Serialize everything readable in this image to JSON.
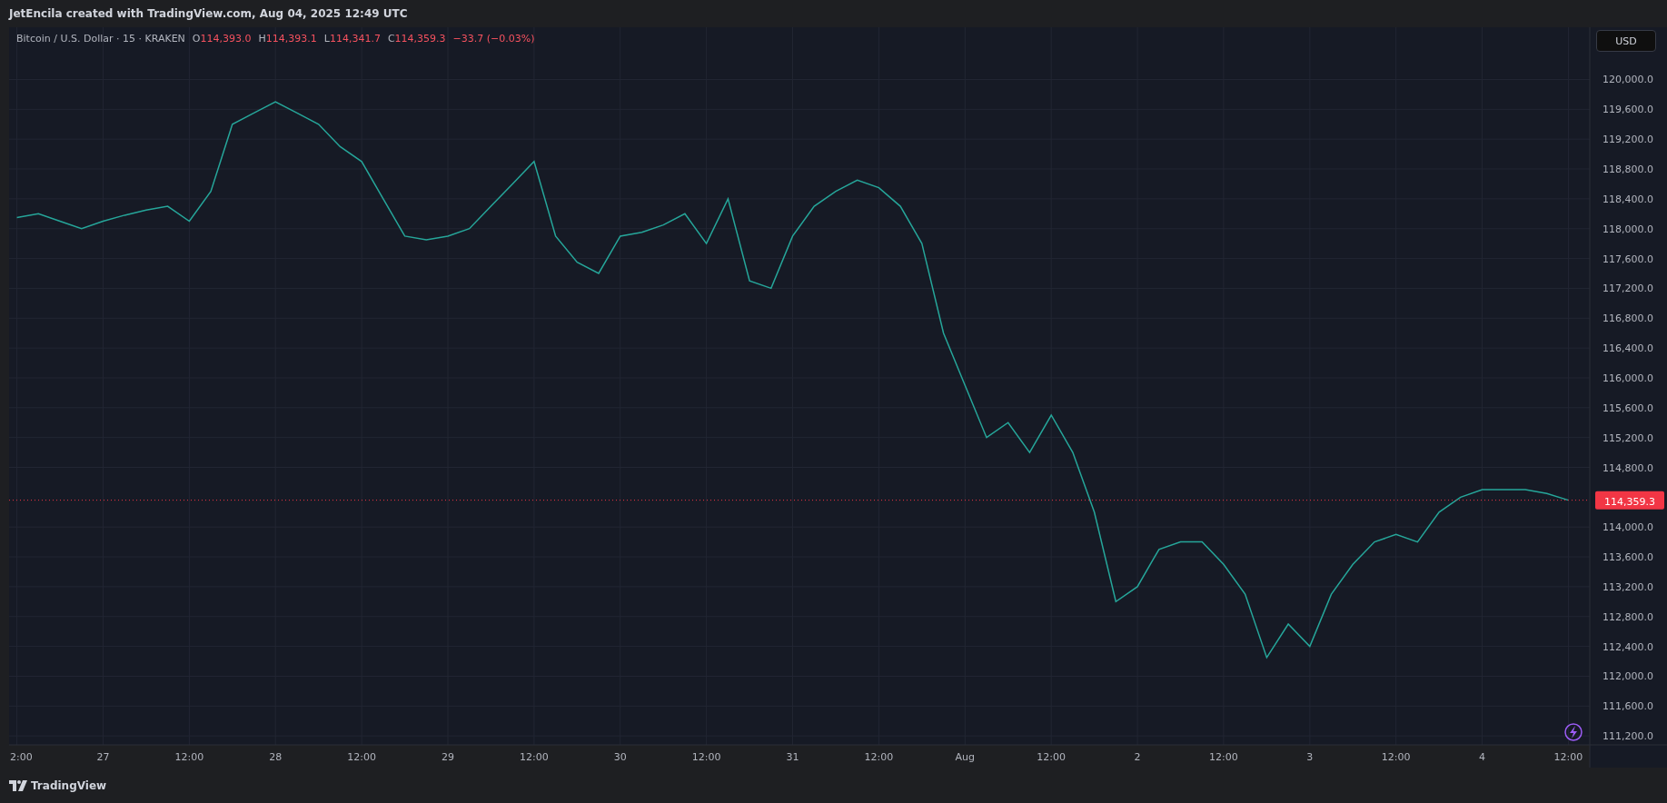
{
  "header": {
    "caption": "JetEncila created with TradingView.com, Aug 04, 2025 12:49 UTC"
  },
  "legend": {
    "symbol": "Bitcoin / U.S. Dollar · 15 · KRAKEN",
    "ohlc": [
      {
        "label": "O",
        "value": "114,393.0"
      },
      {
        "label": "H",
        "value": "114,393.1"
      },
      {
        "label": "L",
        "value": "114,341.7"
      },
      {
        "label": "C",
        "value": "114,359.3"
      }
    ],
    "change": "−33.7 (−0.03%)"
  },
  "currency_button": {
    "label": "USD"
  },
  "last_price": {
    "label": "114,359.3"
  },
  "chart_data": {
    "type": "line",
    "categories": [
      "2:00",
      null,
      null,
      null,
      "27",
      null,
      null,
      null,
      "12:00",
      null,
      null,
      null,
      "28",
      null,
      null,
      null,
      "12:00",
      null,
      null,
      null,
      "29",
      null,
      null,
      null,
      "12:00",
      null,
      null,
      null,
      "30",
      null,
      null,
      null,
      "12:00",
      null,
      null,
      null,
      "31",
      null,
      null,
      null,
      "12:00",
      null,
      null,
      null,
      "Aug",
      null,
      null,
      null,
      "12:00",
      null,
      null,
      null,
      "2",
      null,
      null,
      null,
      "12:00",
      null,
      null,
      null,
      "3",
      null,
      null,
      null,
      "12:00",
      null,
      null,
      null,
      "4",
      null,
      null,
      null,
      "12:00"
    ],
    "series": [
      {
        "color": "#26a69a",
        "values": [
          118150,
          118200,
          118100,
          118000,
          118100,
          118180,
          118250,
          118300,
          118100,
          118500,
          119400,
          119550,
          119700,
          119550,
          119400,
          119100,
          118900,
          118400,
          117900,
          117850,
          117900,
          118000,
          118300,
          118600,
          118900,
          117900,
          117550,
          117400,
          117900,
          117950,
          118050,
          118200,
          117800,
          118400,
          117300,
          117200,
          117900,
          118300,
          118500,
          118650,
          118550,
          118300,
          117800,
          116600,
          115900,
          115200,
          115400,
          115000,
          115500,
          115000,
          114200,
          113000,
          113200,
          113700,
          113800,
          113800,
          113500,
          113100,
          112250,
          112700,
          112400,
          113100,
          113500,
          113800,
          113900,
          113800,
          114200,
          114400,
          114500,
          114500,
          114500,
          114450,
          114360
        ]
      }
    ],
    "ylim": [
      111080,
      120700
    ],
    "grid": true,
    "ref_lines": [
      {
        "axis": "y",
        "value": 114360,
        "color": "#f23645"
      }
    ],
    "yticks": [
      {
        "value": 120000,
        "label": "120,000.0"
      },
      {
        "value": 119600,
        "label": "119,600.0"
      },
      {
        "value": 119200,
        "label": "119,200.0"
      },
      {
        "value": 118800,
        "label": "118,800.0"
      },
      {
        "value": 118400,
        "label": "118,400.0"
      },
      {
        "value": 118000,
        "label": "118,000.0"
      },
      {
        "value": 117600,
        "label": "117,600.0"
      },
      {
        "value": 117200,
        "label": "117,200.0"
      },
      {
        "value": 116800,
        "label": "116,800.0"
      },
      {
        "value": 116400,
        "label": "116,400.0"
      },
      {
        "value": 116000,
        "label": "116,000.0"
      },
      {
        "value": 115600,
        "label": "115,600.0"
      },
      {
        "value": 115200,
        "label": "115,200.0"
      },
      {
        "value": 114800,
        "label": "114,800.0"
      },
      {
        "value": 114000,
        "label": "114,000.0"
      },
      {
        "value": 113600,
        "label": "113,600.0"
      },
      {
        "value": 113200,
        "label": "113,200.0"
      },
      {
        "value": 112800,
        "label": "112,800.0"
      },
      {
        "value": 112400,
        "label": "112,400.0"
      },
      {
        "value": 112000,
        "label": "112,000.0"
      },
      {
        "value": 111600,
        "label": "111,600.0"
      },
      {
        "value": 111200,
        "label": "111,200.0"
      }
    ]
  },
  "footer": {
    "brand": "TradingView"
  }
}
